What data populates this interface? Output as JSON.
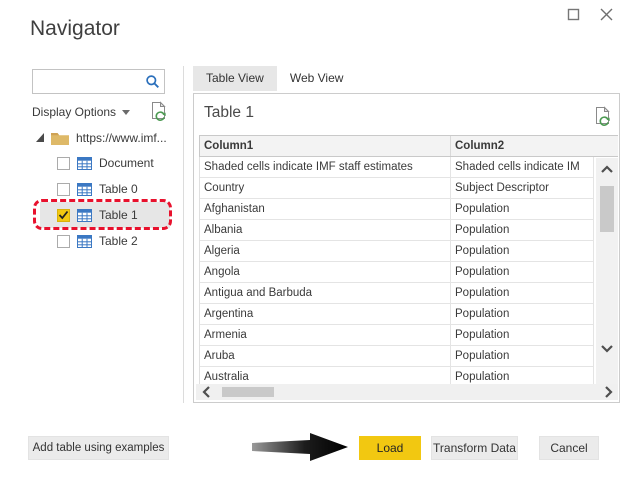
{
  "window": {
    "title": "Navigator",
    "controls": {
      "maximize_icon": "maximize",
      "close_icon": "close"
    }
  },
  "left_panel": {
    "search": {
      "value": "",
      "placeholder": ""
    },
    "display_options_label": "Display Options",
    "tree": {
      "root": {
        "label": "https://www.imf..."
      },
      "items": [
        {
          "label": "Document",
          "checked": false,
          "selected": false
        },
        {
          "label": "Table 0",
          "checked": false,
          "selected": false
        },
        {
          "label": "Table 1",
          "checked": true,
          "selected": true
        },
        {
          "label": "Table 2",
          "checked": false,
          "selected": false
        }
      ]
    },
    "add_table_button_label": "Add table using examples"
  },
  "preview": {
    "tabs": [
      {
        "label": "Table View",
        "active": true
      },
      {
        "label": "Web View",
        "active": false
      }
    ],
    "title": "Table 1",
    "table": {
      "columns": [
        "Column1",
        "Column2"
      ],
      "rows": [
        [
          "Shaded cells indicate IMF staff estimates",
          "Shaded cells indicate IM"
        ],
        [
          "Country",
          "Subject Descriptor"
        ],
        [
          "Afghanistan",
          "Population"
        ],
        [
          "Albania",
          "Population"
        ],
        [
          "Algeria",
          "Population"
        ],
        [
          "Angola",
          "Population"
        ],
        [
          "Antigua and Barbuda",
          "Population"
        ],
        [
          "Argentina",
          "Population"
        ],
        [
          "Armenia",
          "Population"
        ],
        [
          "Aruba",
          "Population"
        ],
        [
          "Australia",
          "Population"
        ]
      ]
    }
  },
  "footer": {
    "load_label": "Load",
    "transform_label": "Transform Data",
    "cancel_label": "Cancel"
  },
  "colors": {
    "accent_yellow": "#F2C811",
    "annotation_red": "#E8112D",
    "table_icon_blue": "#3B78C3",
    "folder_tan": "#DEB968",
    "refresh_green": "#4C9A52",
    "selected_row": "#E6E6E6",
    "tab_active_bg": "#E7E7E7"
  }
}
